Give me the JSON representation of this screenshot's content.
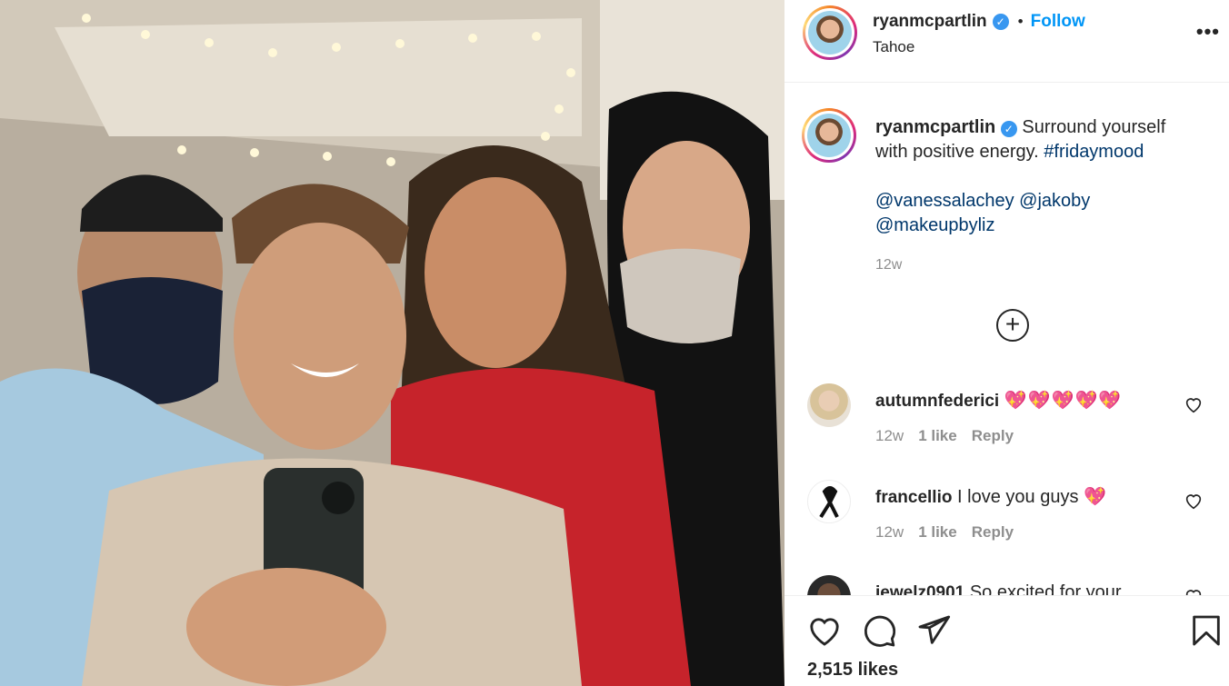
{
  "post": {
    "username": "ryanmcpartlin",
    "verified_mark": "✓",
    "separator": "•",
    "follow_label": "Follow",
    "location": "Tahoe",
    "more_label": "•••"
  },
  "caption": {
    "username": "ryanmcpartlin",
    "text": "Surround yourself with positive energy.",
    "hashtag": "#fridaymood",
    "mention_1": "@vanessalachey",
    "mention_2": "@jakoby",
    "mention_3": "@makeupbyliz",
    "time": "12w",
    "load_more_label": "+"
  },
  "comments": [
    {
      "username": "autumnfederici",
      "text": "",
      "emoji": "💖💖💖💖💖",
      "time": "12w",
      "likes": "1 like",
      "reply": "Reply"
    },
    {
      "username": "francellio",
      "text": "I love you guys",
      "emoji": "💖",
      "time": "12w",
      "likes": "1 like",
      "reply": "Reply"
    },
    {
      "username": "jewelz0901",
      "text": "So excited for your",
      "emoji": "",
      "time": "",
      "likes": "",
      "reply": ""
    }
  ],
  "footer": {
    "likes_count": "2,515 likes"
  },
  "icons": {
    "verified": "verified-badge-icon",
    "more": "more-options-icon",
    "load_more": "plus-circle-icon",
    "like": "heart-icon",
    "comment": "comment-icon",
    "share": "paper-plane-icon",
    "save": "bookmark-icon"
  },
  "colors": {
    "follow": "#0095f6",
    "verified": "#3897f0",
    "link": "#00376b",
    "meta": "#8e8e8e",
    "heart_emoji": "#e0245e"
  }
}
